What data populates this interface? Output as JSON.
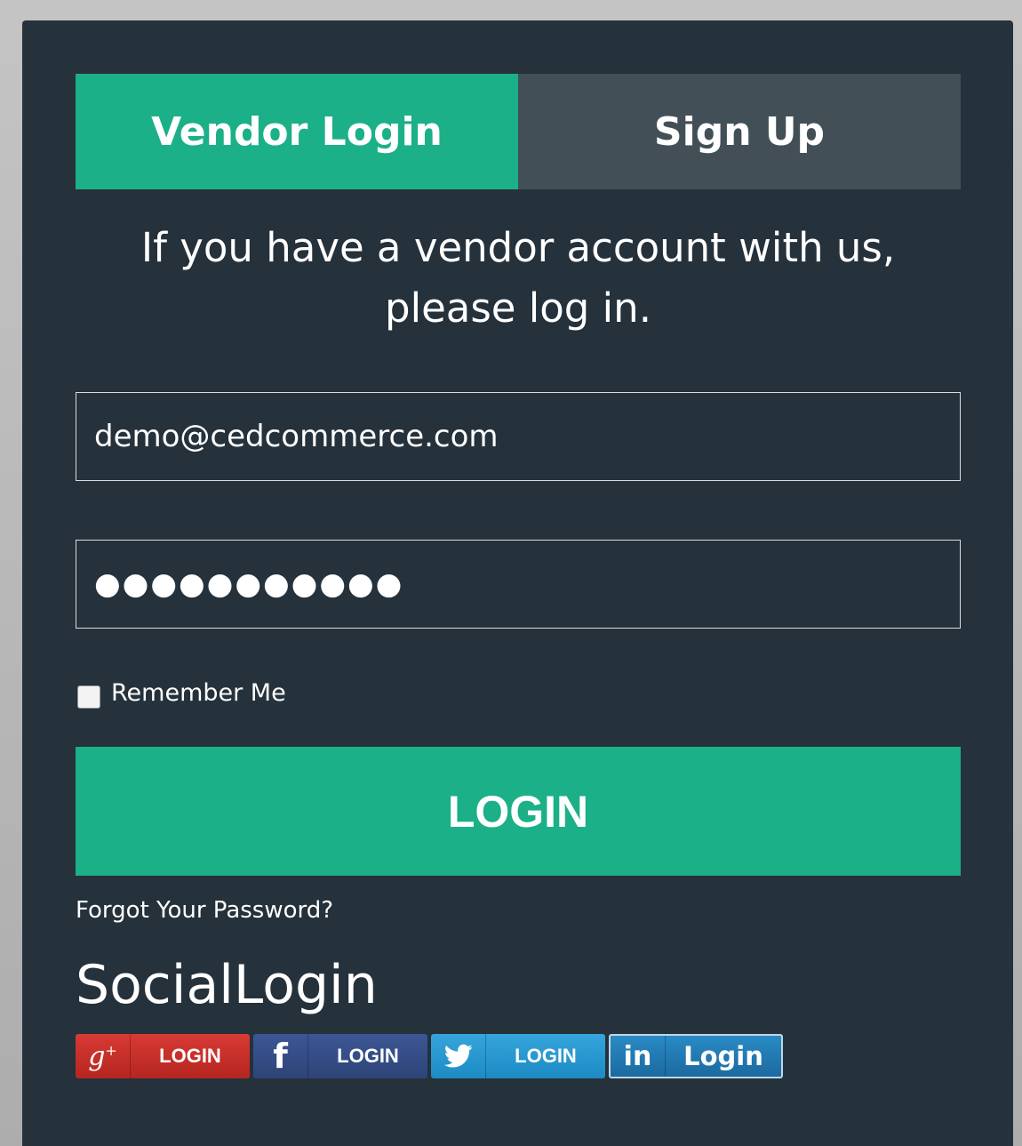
{
  "tabs": {
    "vendor_login": "Vendor Login",
    "sign_up": "Sign Up"
  },
  "intro": {
    "line1": "If you have a vendor account with us,",
    "line2": "please log in."
  },
  "form": {
    "email_value": "demo@cedcommerce.com",
    "password_value": "●●●●●●●●●●●",
    "remember_label": "Remember Me",
    "remember_checked": false,
    "login_label": "LOGIN",
    "forgot_label": "Forgot Your Password?"
  },
  "social": {
    "title": "SocialLogin",
    "buttons": [
      {
        "provider_icon": "google-plus-icon",
        "label": "LOGIN",
        "color": "#c62f2a"
      },
      {
        "provider_icon": "facebook-icon",
        "label": "LOGIN",
        "color": "#34508a"
      },
      {
        "provider_icon": "twitter-icon",
        "label": "LOGIN",
        "color": "#2a98d0"
      },
      {
        "provider_icon": "linkedin-icon",
        "label": "Login",
        "color": "#2379b2"
      }
    ]
  },
  "colors": {
    "accent": "#1bb088",
    "panel": "#25313b",
    "inactive_tab": "#434f57"
  }
}
